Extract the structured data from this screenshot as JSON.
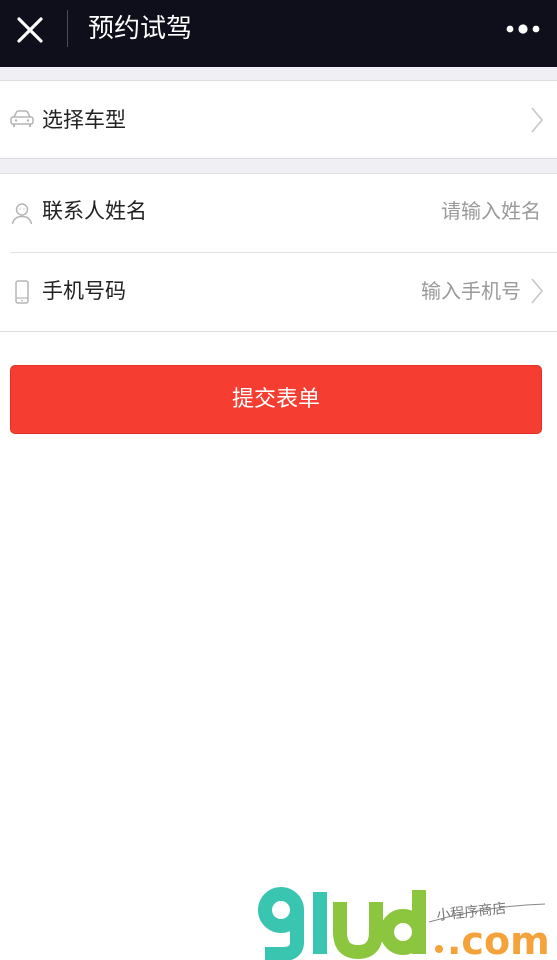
{
  "nav": {
    "title": "预约试驾",
    "close_icon": "close-icon",
    "more_icon": "more-dots-icon"
  },
  "form": {
    "car_select": {
      "label": "选择车型",
      "icon": "car-icon"
    },
    "contact_name": {
      "label": "联系人姓名",
      "placeholder": "请输入姓名",
      "value": "",
      "icon": "person-icon"
    },
    "phone": {
      "label": "手机号码",
      "placeholder": "输入手机号",
      "value": "",
      "icon": "phone-icon"
    }
  },
  "submit": {
    "label": "提交表单"
  },
  "watermark": {
    "logo_text": "91ud",
    "suffix": ".com",
    "tagline": "小程序商店"
  },
  "colors": {
    "titlebar": "#0e0f1a",
    "accent": "#f53d31",
    "section_gap": "#efeff4",
    "watermark_teal": "#39c5b0",
    "watermark_green": "#8cc63f",
    "watermark_orange": "#f6a23a"
  }
}
